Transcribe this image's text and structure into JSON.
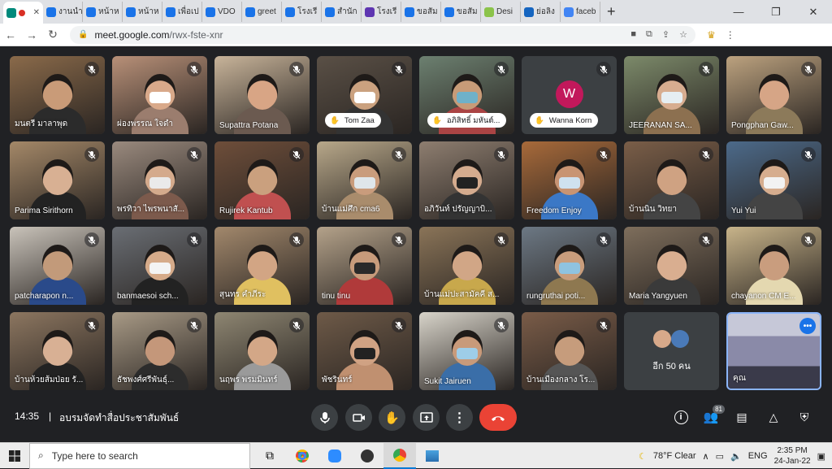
{
  "browser": {
    "tabs": [
      {
        "label": "",
        "icon": "meet-icon",
        "color": "#00897b",
        "active": true
      },
      {
        "label": "งานนำ",
        "icon": "google-sites-icon",
        "color": "#1a73e8"
      },
      {
        "label": "หน้าห",
        "icon": "google-sites-icon",
        "color": "#1a73e8"
      },
      {
        "label": "หน้าห",
        "icon": "google-sites-icon",
        "color": "#1a73e8"
      },
      {
        "label": "เพื่อเป",
        "icon": "google-sites-icon",
        "color": "#1a73e8"
      },
      {
        "label": "VDO",
        "icon": "google-sites-icon",
        "color": "#1a73e8"
      },
      {
        "label": "greet",
        "icon": "google-sites-icon",
        "color": "#1a73e8"
      },
      {
        "label": "โรงเรี",
        "icon": "google-sites-icon",
        "color": "#1a73e8"
      },
      {
        "label": "สำนัก",
        "icon": "google-sites-icon",
        "color": "#1a73e8"
      },
      {
        "label": "โรงเรี",
        "icon": "mail-icon",
        "color": "#5e35b1"
      },
      {
        "label": "ขอสัม",
        "icon": "google-sites-icon",
        "color": "#1a73e8"
      },
      {
        "label": "ขอสัม",
        "icon": "google-sites-icon",
        "color": "#1a73e8"
      },
      {
        "label": "Desi",
        "icon": "u-icon",
        "color": "#8bc34a"
      },
      {
        "label": "ย่อลิง",
        "icon": "s-icon",
        "color": "#1565c0"
      },
      {
        "label": "faceb",
        "icon": "google-icon",
        "color": "#4285f4"
      }
    ],
    "url_host": "meet.google.com",
    "url_path": "/rwx-fste-xnr",
    "new_tab": "+",
    "min": "—",
    "max": "❐",
    "close": "✕"
  },
  "tiles": [
    {
      "name": "มนตรี มาลาพุด",
      "bg": "#8a6a4a",
      "skin": "#c99b78",
      "shirt": "#2b2b2b",
      "muted": true
    },
    {
      "name": "ผ่องพรรณ ใจดำ",
      "bg": "#b89078",
      "skin": "#d9a98a",
      "shirt": "#9b7d6e",
      "mask": "#ffffff",
      "muted": true
    },
    {
      "name": "Supattra Potana",
      "bg": "#c8b49a",
      "skin": "#d8a585",
      "shirt": "#6b5a50",
      "muted": true
    },
    {
      "name": "Tom Zaa",
      "bg": "#5a5046",
      "skin": "#caa17f",
      "shirt": "#333",
      "mask": "#ffffff",
      "muted": true,
      "pill": true
    },
    {
      "name": "อภิสิทธิ์ มหันต์...",
      "bg": "#6c8070",
      "skin": "#c79b78",
      "shirt": "#aa4444",
      "mask": "#6fb1c9",
      "muted": true,
      "pill": true
    },
    {
      "name": "Wanna Korn",
      "avatar": "W",
      "muted": true,
      "pill": true
    },
    {
      "name": "JEERANAN SA...",
      "bg": "#7c8a6a",
      "skin": "#d7ad90",
      "shirt": "#8c7050",
      "mask": "#e6eef2",
      "muted": true
    },
    {
      "name": "Pongphan Gaw...",
      "bg": "#bca27f",
      "skin": "#d6a586",
      "shirt": "#8c7a5a",
      "muted": true
    },
    {
      "name": "Parima Sirithorn",
      "bg": "#a48868",
      "skin": "#d8b093",
      "shirt": "#222",
      "muted": true
    },
    {
      "name": "พรทิวา ไพรพนาสั...",
      "bg": "#9a8a7e",
      "skin": "#d4aa8c",
      "shirt": "#7c5a4c",
      "mask": "#eaeaea",
      "muted": true
    },
    {
      "name": "Rujirek Kantub",
      "bg": "#6e4e3a",
      "skin": "#caa07e",
      "shirt": "#c05050",
      "muted": true
    },
    {
      "name": "บ้านแม่ศึก cma6",
      "bg": "#b8a88a",
      "skin": "#c99c7c",
      "shirt": "#a98c6c",
      "mask": "#dfe6ea",
      "muted": true
    },
    {
      "name": "อภิวันท์ ปรัญญาบิ...",
      "bg": "#8e7e70",
      "skin": "#d4ab8e",
      "shirt": "#333",
      "mask": "#222",
      "muted": true
    },
    {
      "name": "Freedom Enjoy",
      "bg": "#a86a3a",
      "skin": "#c89473",
      "shirt": "#3b78c6",
      "mask": "#cfe1ef",
      "muted": true
    },
    {
      "name": "บ้านนิน วิทยา",
      "bg": "#7a5e48",
      "skin": "#cfa282",
      "shirt": "#444",
      "muted": true
    },
    {
      "name": "Yui Yui",
      "bg": "#4c6a8a",
      "skin": "#d6ad8e",
      "shirt": "#444",
      "mask": "#f2f2f2",
      "muted": true
    },
    {
      "name": "patcharapon n...",
      "bg": "#c9c3ba",
      "skin": "#c29a7a",
      "shirt": "#2a4a8a",
      "muted": true
    },
    {
      "name": "banmaesoi sch...",
      "bg": "#6a6e74",
      "skin": "#d6ab8a",
      "shirt": "#222",
      "mask": "#f4f4f4",
      "muted": true
    },
    {
      "name": "สุนทร คำภีระ",
      "bg": "#a2886c",
      "skin": "#d2a584",
      "shirt": "#e0c060",
      "muted": true
    },
    {
      "name": "tinu tinu",
      "bg": "#b4a28a",
      "skin": "#c79b7b",
      "shirt": "#b03a3a",
      "mask": "#2a2a2a",
      "muted": true
    },
    {
      "name": "บ้านแม่ปะสามัคคี ส...",
      "bg": "#8a7458",
      "skin": "#d1a686",
      "shirt": "#c8a84c",
      "muted": true
    },
    {
      "name": "rungruthai poti...",
      "bg": "#6c7884",
      "skin": "#c99d7c",
      "shirt": "#8e7850",
      "mask": "#8fc3e0",
      "muted": true
    },
    {
      "name": "Maria Yangyuen",
      "bg": "#7e6e5c",
      "skin": "#d9ae90",
      "shirt": "#3a3a3a",
      "muted": true
    },
    {
      "name": "chayanon CM E...",
      "bg": "#c8b48a",
      "skin": "#c99d7e",
      "shirt": "#e4d8b0",
      "muted": true
    },
    {
      "name": "บ้านห้วยส้มป่อย รั...",
      "bg": "#8c7660",
      "skin": "#d8b094",
      "shirt": "#222",
      "muted": true
    },
    {
      "name": "ธัชพงศ์ศรีพันธุ์...",
      "bg": "#a89a86",
      "skin": "#c4977a",
      "shirt": "#2c2c2c",
      "muted": true
    },
    {
      "name": "นฤพร พรมมินทร์",
      "bg": "#8e8672",
      "skin": "#d3a787",
      "shirt": "#9a9a9a",
      "muted": true
    },
    {
      "name": "พัชรินทร์",
      "bg": "#6e5a48",
      "skin": "#d0a283",
      "shirt": "#c09070",
      "mask": "#222",
      "muted": true
    },
    {
      "name": "Sukit Jairuen",
      "bg": "#d8d4ca",
      "skin": "#c89a7a",
      "shirt": "#3a6ea8",
      "mask": "#9ecde8",
      "muted": true
    },
    {
      "name": "บ้านเมืองกลาง โร...",
      "bg": "#7a5c48",
      "skin": "#c69c7c",
      "shirt": "#555",
      "muted": true
    }
  ],
  "more_tile": {
    "label": "อีก 50 คน"
  },
  "self_tile": {
    "name": "คุณ",
    "bg": "#8a8aa8"
  },
  "controls": {
    "time": "14:35",
    "separator": "|",
    "meeting_name": "อบรมจัดทำสื่อประชาสัมพันธ์",
    "participant_count": "81"
  },
  "taskbar": {
    "search_placeholder": "Type here to search",
    "weather": "78°F  Clear",
    "lang": "ENG",
    "time": "2:35 PM",
    "date": "24-Jan-22"
  }
}
